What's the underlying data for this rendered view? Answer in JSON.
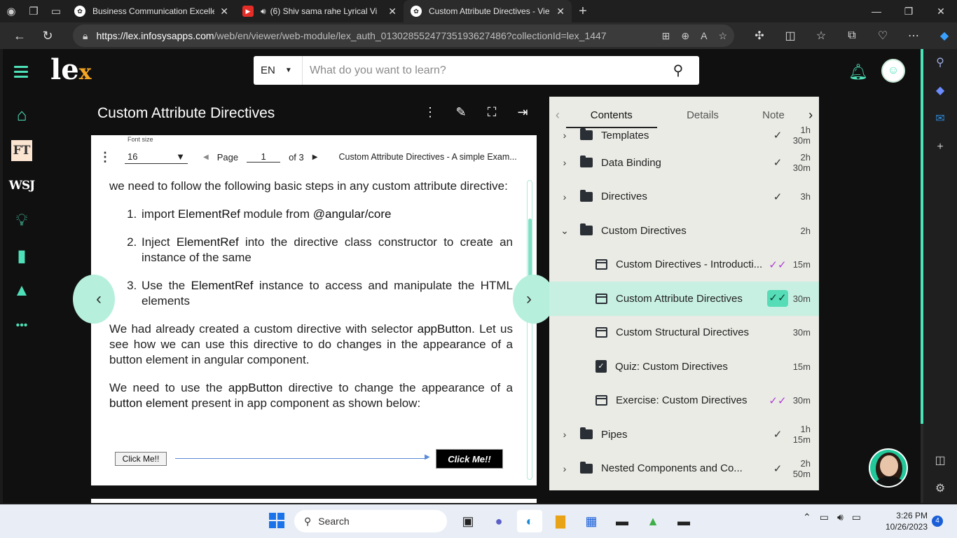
{
  "browser": {
    "tabs": [
      {
        "title": "Business Communication Excelle",
        "active": false
      },
      {
        "title": "(6) Shiv sama rahe Lyrical Vi",
        "active": false
      },
      {
        "title": "Custom Attribute Directives - Vie",
        "active": true
      }
    ],
    "url_host": "https://lex.infosysapps.com",
    "url_path": "/web/en/viewer/web-module/lex_auth_013028552477351936274​86?collectionId=lex_1447..."
  },
  "header": {
    "logo": "le",
    "logo_accent": "x",
    "lang": "EN",
    "search_placeholder": "What do you want to learn?"
  },
  "rail": {
    "ft": "FT",
    "wsj": "WSJ",
    "more": "•••"
  },
  "content": {
    "title": "Custom Attribute Directives"
  },
  "viewer": {
    "font_size_label": "Font size",
    "font_size_value": "16",
    "page_label": "Page",
    "page_value": "1",
    "page_of": "of 3",
    "doc_name": "Custom Attribute Directives - A simple Exam...",
    "intro": "we need to follow the following basic steps in any custom attribute directive:",
    "steps": [
      {
        "pre": "import ",
        "k": "ElementRef",
        "mid": " module from ",
        "k2": "@angular/core",
        "post": ""
      },
      {
        "pre": "Inject ",
        "k": "ElementRef",
        "mid": " into the directive class constructor to create an instance of the same",
        "k2": "",
        "post": ""
      },
      {
        "pre": "Use the ",
        "k": "ElementRef",
        "mid": " instance to access and manipulate the HTML elements",
        "k2": "",
        "post": ""
      }
    ],
    "para1_pre": "We had already created a custom directive with selector ",
    "para1_k": "appButton",
    "para1_post": ". Let us see how we can use this directive to do changes in the appearance of a button element in angular component.",
    "para2_pre": "We need to use the ",
    "para2_k": "appButton",
    "para2_mid": " directive to change the appearance of a ",
    "para2_k2": "button element",
    "para2_post": " present in app component as shown below:",
    "demo_before": "Click Me!!",
    "demo_after": "Click Me!!"
  },
  "panel": {
    "tabs": [
      "Contents",
      "Details",
      "Note"
    ],
    "rows": [
      {
        "type": "folder",
        "name": "Templates",
        "check": "✓",
        "dur": "1h 30m",
        "cut": true
      },
      {
        "type": "folder",
        "name": "Data Binding",
        "check": "✓",
        "dur": "2h 30m"
      },
      {
        "type": "folder",
        "name": "Directives",
        "check": "✓",
        "dur": "3h"
      },
      {
        "type": "folder-open",
        "name": "Custom Directives",
        "check": "",
        "dur": "2h"
      },
      {
        "type": "doc",
        "name": "Custom Directives - Introducti...",
        "check": "✓✓",
        "dur": "15m"
      },
      {
        "type": "doc",
        "name": "Custom Attribute Directives",
        "check": "✓✓",
        "dur": "30m",
        "selected": true
      },
      {
        "type": "doc",
        "name": "Custom Structural Directives",
        "check": "",
        "dur": "30m"
      },
      {
        "type": "quiz",
        "name": "Quiz: Custom Directives",
        "check": "",
        "dur": "15m"
      },
      {
        "type": "doc",
        "name": "Exercise: Custom Directives",
        "check": "✓✓",
        "dur": "30m"
      },
      {
        "type": "folder",
        "name": "Pipes",
        "check": "✓",
        "dur": "1h 15m"
      },
      {
        "type": "folder",
        "name": "Nested Components and Co...",
        "check": "✓",
        "dur": "2h 50m"
      }
    ]
  },
  "taskbar": {
    "search": "Search",
    "time": "3:26 PM",
    "date": "10/26/2023",
    "notifications": "4"
  },
  "colors": {
    "accent": "#4ee0b8",
    "panel_bg": "#eaebe5",
    "selected_row": "#c8f0e2"
  }
}
